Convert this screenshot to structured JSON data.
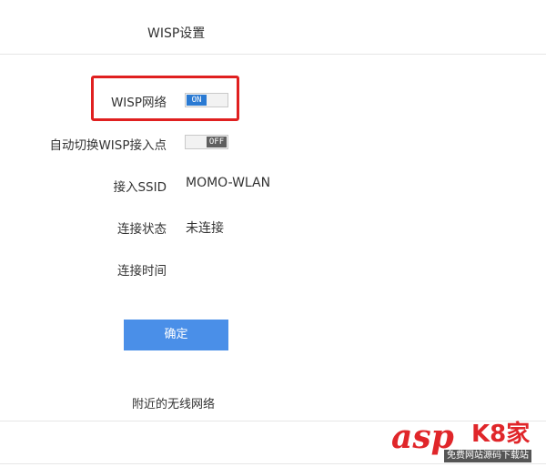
{
  "header": {
    "title": "WISP设置"
  },
  "settings": {
    "wisp": {
      "label": "WISP网络",
      "toggle_text": "ON",
      "state": "on"
    },
    "auto_switch": {
      "label": "自动切换WISP接入点",
      "toggle_text": "OFF",
      "state": "off"
    },
    "ssid": {
      "label": "接入SSID",
      "value": "MOMO-WLAN"
    },
    "status": {
      "label": "连接状态",
      "value": "未连接"
    },
    "time": {
      "label": "连接时间",
      "value": ""
    }
  },
  "confirm_button": {
    "label": "确定"
  },
  "nearby": {
    "title": "附近的无线网络"
  },
  "watermark": {
    "brand": "asp",
    "brand_cn": "K8家",
    "tagline": "免费网站源码下载站"
  },
  "colors": {
    "accent": "#4a8fe8",
    "toggle_on": "#2a7ad3",
    "toggle_off": "#5f5f5f",
    "highlight": "#e02020",
    "watermark": "#e0262a"
  }
}
